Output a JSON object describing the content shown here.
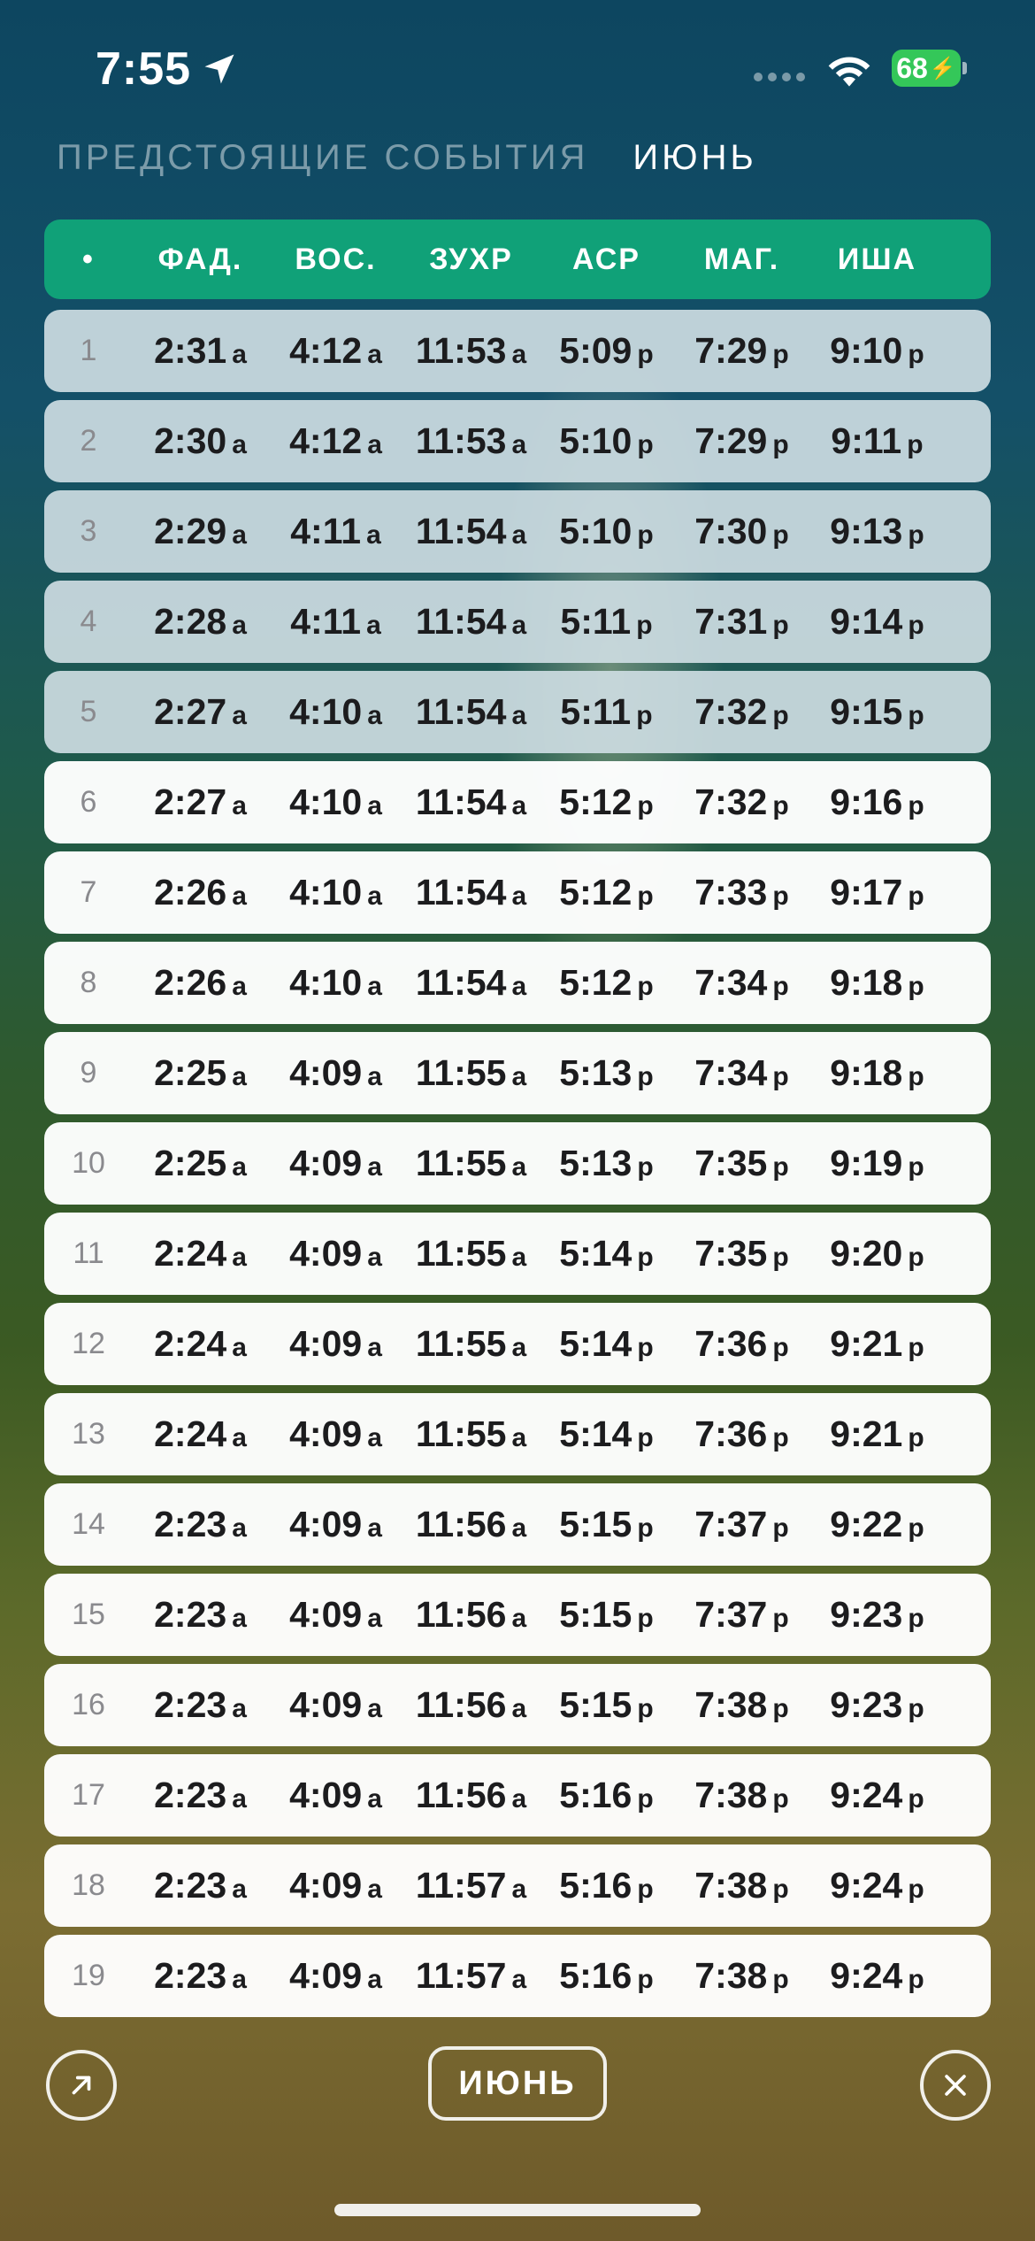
{
  "status_bar": {
    "time": "7:55",
    "battery": "68"
  },
  "tabs": {
    "upcoming": "ПРЕДСТОЯЩИЕ СОБЫТИЯ",
    "month": "ИЮНЬ"
  },
  "table": {
    "headers": {
      "day": "•",
      "fajr": "ФАД.",
      "sunrise": "ВОС.",
      "dhuhr": "ЗУХР",
      "asr": "АСР",
      "maghrib": "МАГ.",
      "isha": "ИША"
    },
    "rows": [
      {
        "day": "1",
        "fajr": "2:31",
        "fs": "a",
        "sunrise": "4:12",
        "ss": "a",
        "dhuhr": "11:53",
        "ds": "a",
        "asr": "5:09",
        "as": "p",
        "maghrib": "7:29",
        "ms": "p",
        "isha": "9:10",
        "is": "p"
      },
      {
        "day": "2",
        "fajr": "2:30",
        "fs": "a",
        "sunrise": "4:12",
        "ss": "a",
        "dhuhr": "11:53",
        "ds": "a",
        "asr": "5:10",
        "as": "p",
        "maghrib": "7:29",
        "ms": "p",
        "isha": "9:11",
        "is": "p"
      },
      {
        "day": "3",
        "fajr": "2:29",
        "fs": "a",
        "sunrise": "4:11",
        "ss": "a",
        "dhuhr": "11:54",
        "ds": "a",
        "asr": "5:10",
        "as": "p",
        "maghrib": "7:30",
        "ms": "p",
        "isha": "9:13",
        "is": "p"
      },
      {
        "day": "4",
        "fajr": "2:28",
        "fs": "a",
        "sunrise": "4:11",
        "ss": "a",
        "dhuhr": "11:54",
        "ds": "a",
        "asr": "5:11",
        "as": "p",
        "maghrib": "7:31",
        "ms": "p",
        "isha": "9:14",
        "is": "p"
      },
      {
        "day": "5",
        "fajr": "2:27",
        "fs": "a",
        "sunrise": "4:10",
        "ss": "a",
        "dhuhr": "11:54",
        "ds": "a",
        "asr": "5:11",
        "as": "p",
        "maghrib": "7:32",
        "ms": "p",
        "isha": "9:15",
        "is": "p"
      },
      {
        "day": "6",
        "fajr": "2:27",
        "fs": "a",
        "sunrise": "4:10",
        "ss": "a",
        "dhuhr": "11:54",
        "ds": "a",
        "asr": "5:12",
        "as": "p",
        "maghrib": "7:32",
        "ms": "p",
        "isha": "9:16",
        "is": "p"
      },
      {
        "day": "7",
        "fajr": "2:26",
        "fs": "a",
        "sunrise": "4:10",
        "ss": "a",
        "dhuhr": "11:54",
        "ds": "a",
        "asr": "5:12",
        "as": "p",
        "maghrib": "7:33",
        "ms": "p",
        "isha": "9:17",
        "is": "p"
      },
      {
        "day": "8",
        "fajr": "2:26",
        "fs": "a",
        "sunrise": "4:10",
        "ss": "a",
        "dhuhr": "11:54",
        "ds": "a",
        "asr": "5:12",
        "as": "p",
        "maghrib": "7:34",
        "ms": "p",
        "isha": "9:18",
        "is": "p"
      },
      {
        "day": "9",
        "fajr": "2:25",
        "fs": "a",
        "sunrise": "4:09",
        "ss": "a",
        "dhuhr": "11:55",
        "ds": "a",
        "asr": "5:13",
        "as": "p",
        "maghrib": "7:34",
        "ms": "p",
        "isha": "9:18",
        "is": "p"
      },
      {
        "day": "10",
        "fajr": "2:25",
        "fs": "a",
        "sunrise": "4:09",
        "ss": "a",
        "dhuhr": "11:55",
        "ds": "a",
        "asr": "5:13",
        "as": "p",
        "maghrib": "7:35",
        "ms": "p",
        "isha": "9:19",
        "is": "p"
      },
      {
        "day": "11",
        "fajr": "2:24",
        "fs": "a",
        "sunrise": "4:09",
        "ss": "a",
        "dhuhr": "11:55",
        "ds": "a",
        "asr": "5:14",
        "as": "p",
        "maghrib": "7:35",
        "ms": "p",
        "isha": "9:20",
        "is": "p"
      },
      {
        "day": "12",
        "fajr": "2:24",
        "fs": "a",
        "sunrise": "4:09",
        "ss": "a",
        "dhuhr": "11:55",
        "ds": "a",
        "asr": "5:14",
        "as": "p",
        "maghrib": "7:36",
        "ms": "p",
        "isha": "9:21",
        "is": "p"
      },
      {
        "day": "13",
        "fajr": "2:24",
        "fs": "a",
        "sunrise": "4:09",
        "ss": "a",
        "dhuhr": "11:55",
        "ds": "a",
        "asr": "5:14",
        "as": "p",
        "maghrib": "7:36",
        "ms": "p",
        "isha": "9:21",
        "is": "p"
      },
      {
        "day": "14",
        "fajr": "2:23",
        "fs": "a",
        "sunrise": "4:09",
        "ss": "a",
        "dhuhr": "11:56",
        "ds": "a",
        "asr": "5:15",
        "as": "p",
        "maghrib": "7:37",
        "ms": "p",
        "isha": "9:22",
        "is": "p"
      },
      {
        "day": "15",
        "fajr": "2:23",
        "fs": "a",
        "sunrise": "4:09",
        "ss": "a",
        "dhuhr": "11:56",
        "ds": "a",
        "asr": "5:15",
        "as": "p",
        "maghrib": "7:37",
        "ms": "p",
        "isha": "9:23",
        "is": "p"
      },
      {
        "day": "16",
        "fajr": "2:23",
        "fs": "a",
        "sunrise": "4:09",
        "ss": "a",
        "dhuhr": "11:56",
        "ds": "a",
        "asr": "5:15",
        "as": "p",
        "maghrib": "7:38",
        "ms": "p",
        "isha": "9:23",
        "is": "p"
      },
      {
        "day": "17",
        "fajr": "2:23",
        "fs": "a",
        "sunrise": "4:09",
        "ss": "a",
        "dhuhr": "11:56",
        "ds": "a",
        "asr": "5:16",
        "as": "p",
        "maghrib": "7:38",
        "ms": "p",
        "isha": "9:24",
        "is": "p"
      },
      {
        "day": "18",
        "fajr": "2:23",
        "fs": "a",
        "sunrise": "4:09",
        "ss": "a",
        "dhuhr": "11:57",
        "ds": "a",
        "asr": "5:16",
        "as": "p",
        "maghrib": "7:38",
        "ms": "p",
        "isha": "9:24",
        "is": "p"
      },
      {
        "day": "19",
        "fajr": "2:23",
        "fs": "a",
        "sunrise": "4:09",
        "ss": "a",
        "dhuhr": "11:57",
        "ds": "a",
        "asr": "5:16",
        "as": "p",
        "maghrib": "7:38",
        "ms": "p",
        "isha": "9:24",
        "is": "p"
      }
    ],
    "past_days": 5
  },
  "bottom_bar": {
    "month_button": "ИЮНЬ"
  },
  "colors": {
    "header": "#10a178",
    "battery": "#34c759"
  }
}
